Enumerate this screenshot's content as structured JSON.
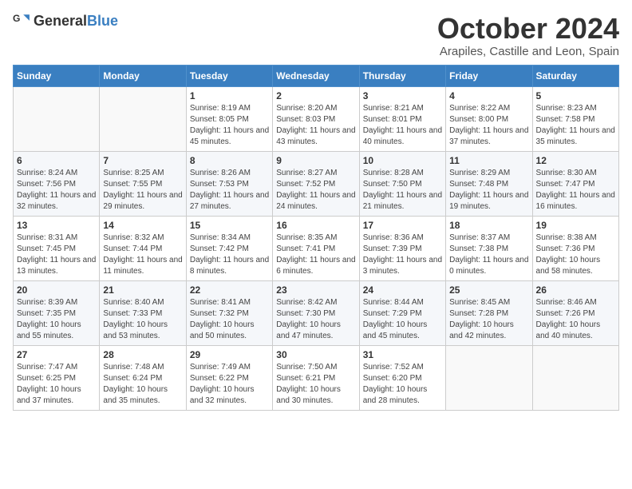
{
  "logo": {
    "text_general": "General",
    "text_blue": "Blue"
  },
  "header": {
    "month": "October 2024",
    "location": "Arapiles, Castille and Leon, Spain"
  },
  "days_of_week": [
    "Sunday",
    "Monday",
    "Tuesday",
    "Wednesday",
    "Thursday",
    "Friday",
    "Saturday"
  ],
  "weeks": [
    [
      {
        "day": "",
        "info": ""
      },
      {
        "day": "",
        "info": ""
      },
      {
        "day": "1",
        "info": "Sunrise: 8:19 AM\nSunset: 8:05 PM\nDaylight: 11 hours and 45 minutes."
      },
      {
        "day": "2",
        "info": "Sunrise: 8:20 AM\nSunset: 8:03 PM\nDaylight: 11 hours and 43 minutes."
      },
      {
        "day": "3",
        "info": "Sunrise: 8:21 AM\nSunset: 8:01 PM\nDaylight: 11 hours and 40 minutes."
      },
      {
        "day": "4",
        "info": "Sunrise: 8:22 AM\nSunset: 8:00 PM\nDaylight: 11 hours and 37 minutes."
      },
      {
        "day": "5",
        "info": "Sunrise: 8:23 AM\nSunset: 7:58 PM\nDaylight: 11 hours and 35 minutes."
      }
    ],
    [
      {
        "day": "6",
        "info": "Sunrise: 8:24 AM\nSunset: 7:56 PM\nDaylight: 11 hours and 32 minutes."
      },
      {
        "day": "7",
        "info": "Sunrise: 8:25 AM\nSunset: 7:55 PM\nDaylight: 11 hours and 29 minutes."
      },
      {
        "day": "8",
        "info": "Sunrise: 8:26 AM\nSunset: 7:53 PM\nDaylight: 11 hours and 27 minutes."
      },
      {
        "day": "9",
        "info": "Sunrise: 8:27 AM\nSunset: 7:52 PM\nDaylight: 11 hours and 24 minutes."
      },
      {
        "day": "10",
        "info": "Sunrise: 8:28 AM\nSunset: 7:50 PM\nDaylight: 11 hours and 21 minutes."
      },
      {
        "day": "11",
        "info": "Sunrise: 8:29 AM\nSunset: 7:48 PM\nDaylight: 11 hours and 19 minutes."
      },
      {
        "day": "12",
        "info": "Sunrise: 8:30 AM\nSunset: 7:47 PM\nDaylight: 11 hours and 16 minutes."
      }
    ],
    [
      {
        "day": "13",
        "info": "Sunrise: 8:31 AM\nSunset: 7:45 PM\nDaylight: 11 hours and 13 minutes."
      },
      {
        "day": "14",
        "info": "Sunrise: 8:32 AM\nSunset: 7:44 PM\nDaylight: 11 hours and 11 minutes."
      },
      {
        "day": "15",
        "info": "Sunrise: 8:34 AM\nSunset: 7:42 PM\nDaylight: 11 hours and 8 minutes."
      },
      {
        "day": "16",
        "info": "Sunrise: 8:35 AM\nSunset: 7:41 PM\nDaylight: 11 hours and 6 minutes."
      },
      {
        "day": "17",
        "info": "Sunrise: 8:36 AM\nSunset: 7:39 PM\nDaylight: 11 hours and 3 minutes."
      },
      {
        "day": "18",
        "info": "Sunrise: 8:37 AM\nSunset: 7:38 PM\nDaylight: 11 hours and 0 minutes."
      },
      {
        "day": "19",
        "info": "Sunrise: 8:38 AM\nSunset: 7:36 PM\nDaylight: 10 hours and 58 minutes."
      }
    ],
    [
      {
        "day": "20",
        "info": "Sunrise: 8:39 AM\nSunset: 7:35 PM\nDaylight: 10 hours and 55 minutes."
      },
      {
        "day": "21",
        "info": "Sunrise: 8:40 AM\nSunset: 7:33 PM\nDaylight: 10 hours and 53 minutes."
      },
      {
        "day": "22",
        "info": "Sunrise: 8:41 AM\nSunset: 7:32 PM\nDaylight: 10 hours and 50 minutes."
      },
      {
        "day": "23",
        "info": "Sunrise: 8:42 AM\nSunset: 7:30 PM\nDaylight: 10 hours and 47 minutes."
      },
      {
        "day": "24",
        "info": "Sunrise: 8:44 AM\nSunset: 7:29 PM\nDaylight: 10 hours and 45 minutes."
      },
      {
        "day": "25",
        "info": "Sunrise: 8:45 AM\nSunset: 7:28 PM\nDaylight: 10 hours and 42 minutes."
      },
      {
        "day": "26",
        "info": "Sunrise: 8:46 AM\nSunset: 7:26 PM\nDaylight: 10 hours and 40 minutes."
      }
    ],
    [
      {
        "day": "27",
        "info": "Sunrise: 7:47 AM\nSunset: 6:25 PM\nDaylight: 10 hours and 37 minutes."
      },
      {
        "day": "28",
        "info": "Sunrise: 7:48 AM\nSunset: 6:24 PM\nDaylight: 10 hours and 35 minutes."
      },
      {
        "day": "29",
        "info": "Sunrise: 7:49 AM\nSunset: 6:22 PM\nDaylight: 10 hours and 32 minutes."
      },
      {
        "day": "30",
        "info": "Sunrise: 7:50 AM\nSunset: 6:21 PM\nDaylight: 10 hours and 30 minutes."
      },
      {
        "day": "31",
        "info": "Sunrise: 7:52 AM\nSunset: 6:20 PM\nDaylight: 10 hours and 28 minutes."
      },
      {
        "day": "",
        "info": ""
      },
      {
        "day": "",
        "info": ""
      }
    ]
  ]
}
